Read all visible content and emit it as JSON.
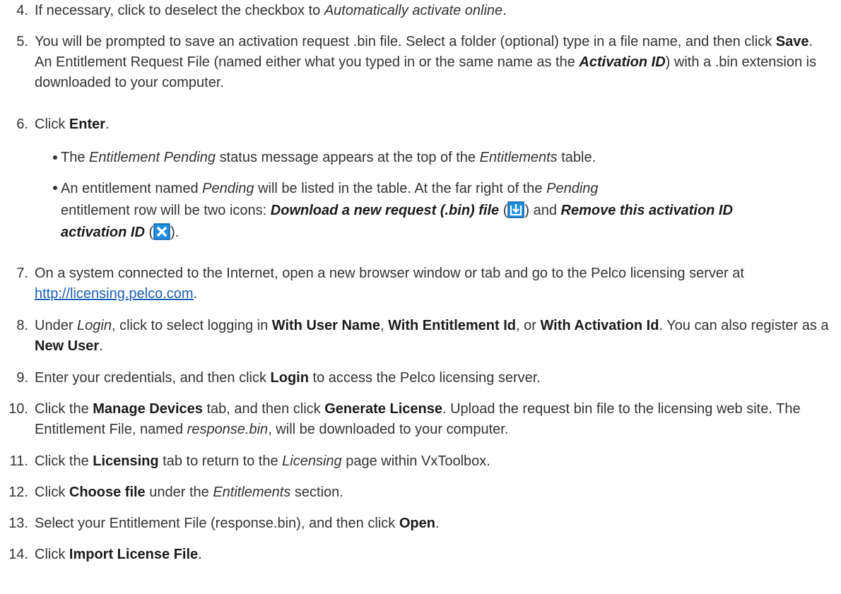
{
  "steps": [
    {
      "num": "4.",
      "p": [
        "If necessary, click to deselect the checkbox to ",
        "Automatically activate online",
        "."
      ]
    },
    {
      "num": "5.",
      "p": [
        "You will be prompted to save an activation request .bin file. Select a folder (optional) type in a file name, and then click ",
        "Save",
        ".",
        "An Entitlement Request File (named either what you typed in or the same name as the ",
        "Activation ID",
        ") with a .bin extension is downloaded to your computer."
      ]
    },
    {
      "num": "6.",
      "p": [
        "Click ",
        "Enter",
        "."
      ]
    },
    {
      "num": "7.",
      "p": [
        "On a system connected to the Internet, open a new browser window or tab and go to the Pelco licensing server at ",
        "http://licensing.pelco.com",
        "."
      ]
    },
    {
      "num": "8.",
      "p": [
        "Under ",
        "Login",
        ", click to select logging in ",
        "With User Name",
        ", ",
        "With Entitlement Id",
        ", or ",
        "With Activation Id",
        ". You can also register as a ",
        "New User",
        "."
      ]
    },
    {
      "num": "9.",
      "p": [
        "Enter your credentials, and then click ",
        "Login",
        " to access the Pelco licensing server."
      ]
    },
    {
      "num": "10.",
      "p": [
        "Click the ",
        "Manage Devices",
        " tab, and then click ",
        "Generate License",
        ". Upload the request bin file to the licensing web site. The Entitlement File, named ",
        "response.bin",
        ", will be downloaded to your computer."
      ]
    },
    {
      "num": "11.",
      "p": [
        "Click the ",
        "Licensing",
        " tab to return to the ",
        "Licensing",
        " page within VxToolbox."
      ]
    },
    {
      "num": "12.",
      "p": [
        "Click ",
        "Choose file",
        " under the ",
        "Entitlements",
        " section."
      ]
    },
    {
      "num": "13.",
      "p": [
        "Select your Entitlement File (response.bin), and then click ",
        "Open",
        "."
      ]
    },
    {
      "num": "14.",
      "p": [
        "Click ",
        "Import License File",
        "."
      ]
    }
  ],
  "bullets": [
    {
      "p": [
        "The ",
        "Entitlement Pending",
        " status message appears at the top of the ",
        "Entitlements",
        " table."
      ]
    },
    {
      "p": [
        "An entitlement named ",
        "Pending",
        " will be listed in the table. At the far right of the ",
        "Pending",
        " entitlement row will be two icons: ",
        "Download a new request (.bin) file",
        " (",
        ") and ",
        "Remove this activation ID",
        " (",
        ")."
      ]
    }
  ],
  "icons": {
    "download": "download-arrow-icon",
    "remove": "remove-x-icon",
    "accent": "#1e90e0"
  }
}
